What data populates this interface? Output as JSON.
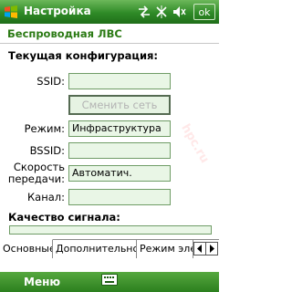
{
  "titlebar": {
    "title": "Настройка",
    "ok_label": "ok"
  },
  "section_header": "Беспроводная ЛВС",
  "group_title": "Текущая конфигурация:",
  "fields": {
    "ssid": {
      "label": "SSID:",
      "value": ""
    },
    "change_network_label": "Сменить сеть",
    "mode": {
      "label": "Режим:",
      "value": "Инфраструктура"
    },
    "bssid": {
      "label": "BSSID:",
      "value": ""
    },
    "speed": {
      "label_line1": "Скорость",
      "label_line2": "передачи:",
      "value": "Автоматич."
    },
    "channel": {
      "label": "Канал:",
      "value": ""
    }
  },
  "signal": {
    "label": "Качество сигнала:",
    "level": 0
  },
  "tabs": [
    {
      "label": "Основные",
      "active": true
    },
    {
      "label": "Дополнительно",
      "active": false
    },
    {
      "label": "Режим эле",
      "active": false
    }
  ],
  "bottombar": {
    "menu_label": "Меню"
  },
  "watermark": "hpc.ru",
  "colors": {
    "accent": "#2f8a27",
    "field_bg": "#e9f6e6",
    "header_text": "#2b7a14"
  }
}
